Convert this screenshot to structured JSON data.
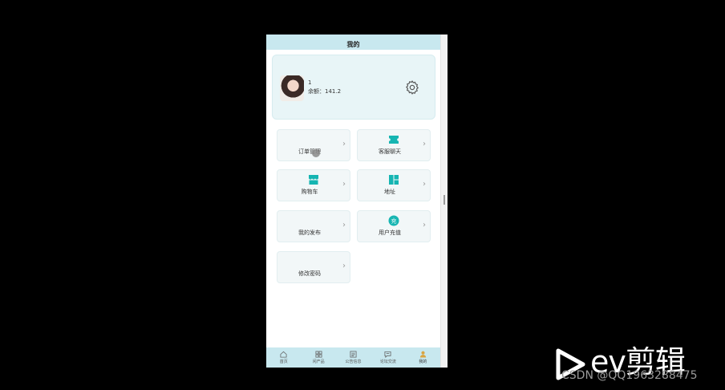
{
  "header": {
    "title": "我的"
  },
  "profile": {
    "name": "1",
    "balance": "余额：141.2"
  },
  "menu": [
    {
      "label": "订单管理",
      "icon": "none"
    },
    {
      "label": "客服聊天",
      "icon": "ticket-icon"
    },
    {
      "label": "购物车",
      "icon": "shop-icon"
    },
    {
      "label": "地址",
      "icon": "grid-icon"
    },
    {
      "label": "我的发布",
      "icon": "none"
    },
    {
      "label": "用户充值",
      "icon": "recharge-icon",
      "icon_text": "充"
    },
    {
      "label": "修改密码",
      "icon": "none"
    }
  ],
  "tabs": [
    {
      "label": "首页",
      "icon": "home-icon"
    },
    {
      "label": "闲产品",
      "icon": "grid-icon"
    },
    {
      "label": "公告信息",
      "icon": "doc-icon"
    },
    {
      "label": "论坛交流",
      "icon": "message-icon"
    },
    {
      "label": "我的",
      "icon": "user-icon",
      "active": true
    }
  ],
  "chevron": "›",
  "watermark": {
    "brand": "ev剪辑",
    "credit": "CSDN @QQ1963288475"
  },
  "colors": {
    "accent": "#16b5b2",
    "bar": "#c8e8ef",
    "card": "#e8f5f7"
  }
}
